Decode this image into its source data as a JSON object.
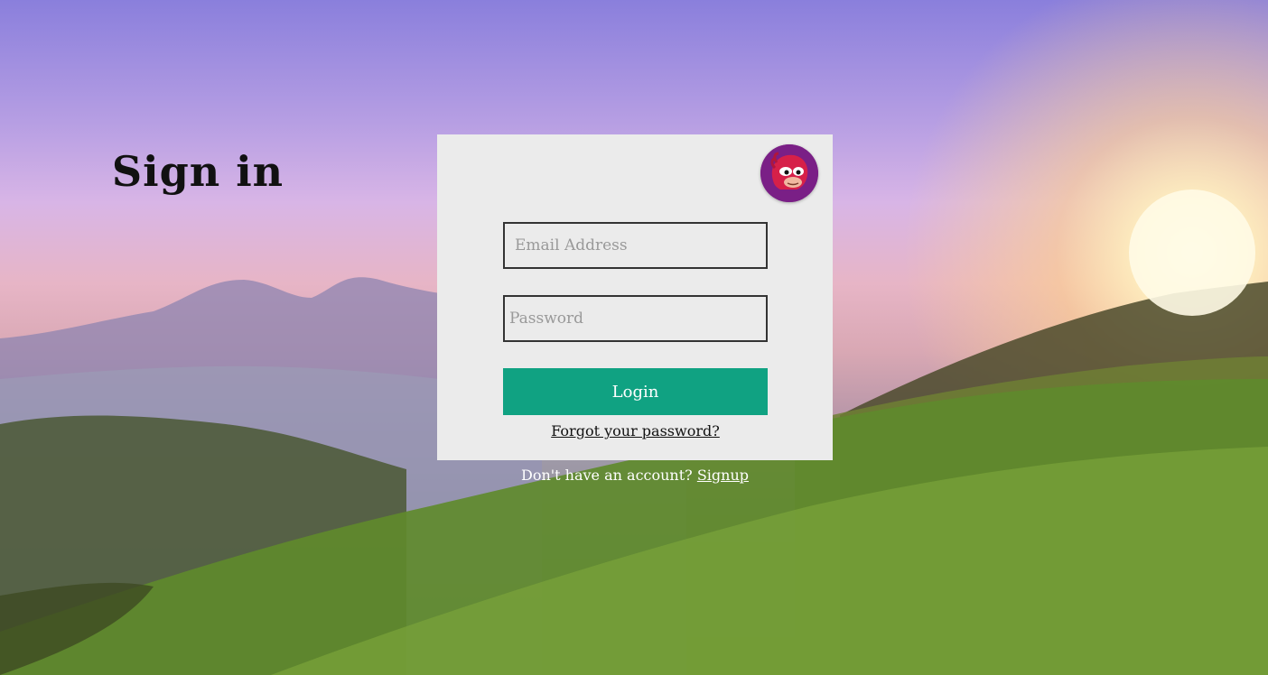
{
  "page": {
    "background_icon": "blurred-mountain-sunset-landscape"
  },
  "login_card": {
    "title": "Sign in",
    "avatar_icon": "red-echidna-avatar",
    "email": {
      "placeholder": "Email Address",
      "value": ""
    },
    "password": {
      "placeholder": "Password",
      "value": ""
    },
    "login_label": "Login",
    "forgot_label": "Forgot your password?"
  },
  "signup": {
    "prompt": "Don't have an account?",
    "link_label": "Signup"
  },
  "colors": {
    "card_background": "#ebebeb",
    "login_button": "#10a282",
    "avatar_ring": "#7a1f86"
  }
}
